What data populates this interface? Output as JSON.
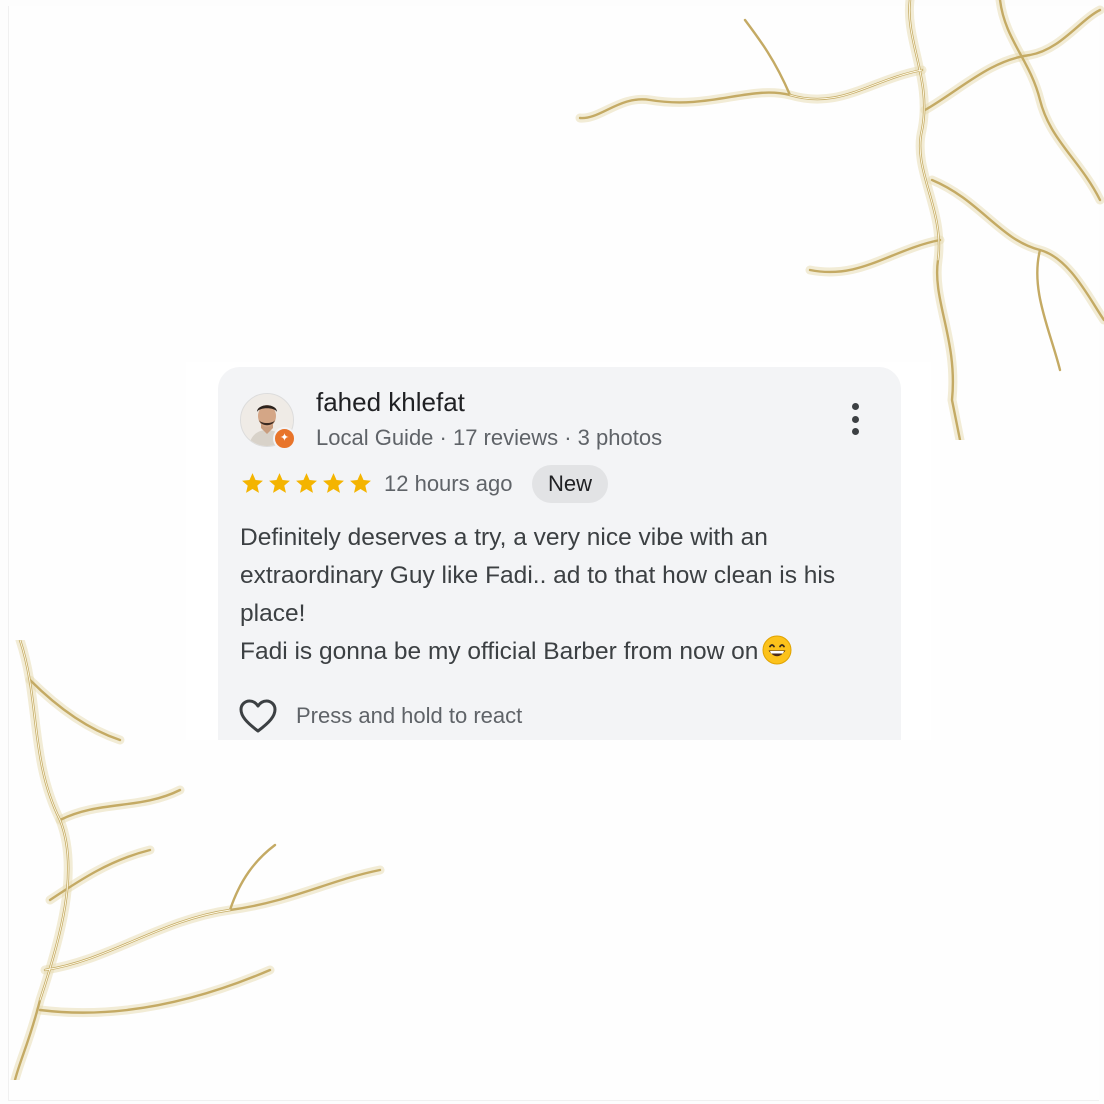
{
  "review": {
    "author_name": "fahed khlefat",
    "author_meta": "Local Guide · 17 reviews · 3 photos",
    "rating": 5,
    "rating_max": 5,
    "time_ago": "12 hours ago",
    "badge": "New",
    "text_paragraphs": [
      "Definitely deserves a try, a very nice vibe with an extraordinary Guy like Fadi.. ad to that how clean is his place!",
      "Fadi is gonna be my official Barber from now on"
    ],
    "react_label": "Press and hold to react"
  },
  "icons": {
    "more": "more-vert-icon",
    "star": "star-icon",
    "heart": "heart-outline-icon",
    "local_guide": "local-guide-badge-icon",
    "emoji": "grinning-face-emoji"
  },
  "colors": {
    "star": "#f4b400",
    "card_background": "#f3f4f6",
    "local_guide_badge": "#e8742a",
    "decoration_gold": "#c4aa64"
  }
}
